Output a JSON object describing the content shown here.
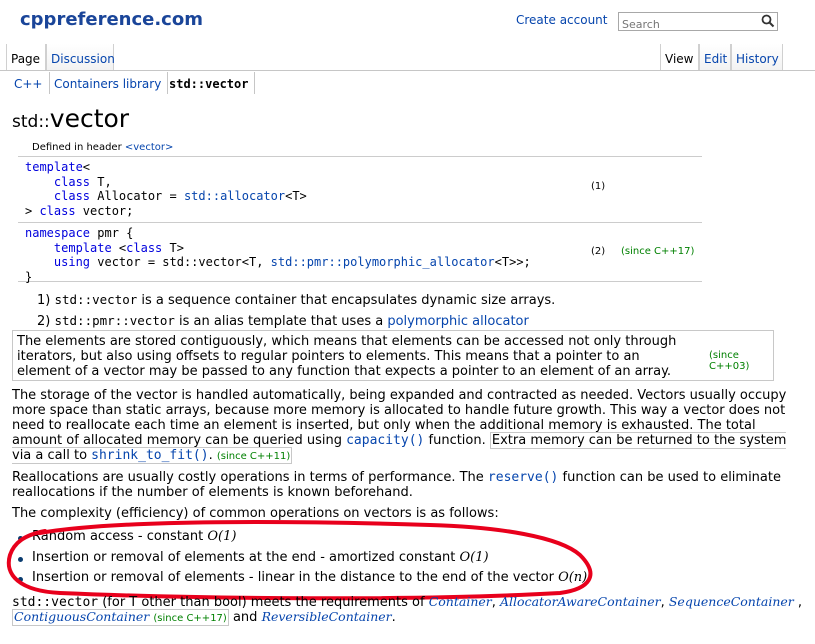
{
  "header": {
    "logo": "cppreference.com",
    "create_account": "Create account",
    "search_placeholder": "Search"
  },
  "tabs": {
    "page": "Page",
    "discussion": "Discussion",
    "view": "View",
    "edit": "Edit",
    "history": "History"
  },
  "breadcrumb": [
    "C++",
    "Containers library",
    "std::vector"
  ],
  "title": {
    "namespace": "std::",
    "name": "vector"
  },
  "declaration": {
    "defined_in_prefix": "Defined in header ",
    "header": "<vector>",
    "decl1": {
      "line1_kw": "template",
      "line1_rest": "<",
      "line2_kw": "class",
      "line2_rest": " T,",
      "line3_kw": "class",
      "line3_mid": " Allocator = ",
      "line3_id": "std::allocator",
      "line3_end": "<T>",
      "line4_pre": "> ",
      "line4_kw": "class",
      "line4_rest": " vector;",
      "number": "(1)"
    },
    "decl2": {
      "line1_kw": "namespace",
      "line1_rest": " pmr {",
      "line2_kw": "template",
      "line2_mid": " <",
      "line2_kw2": "class",
      "line2_end": " T>",
      "line3_kw": "using",
      "line3_mid": " vector = ",
      "line3_id1": "std::vector",
      "line3_mid2": "<T, ",
      "line3_id2": "std::pmr::polymorphic_allocator",
      "line3_end": "<T>>;",
      "line4": "}",
      "number": "(2)",
      "since": "(since C++17)"
    }
  },
  "descriptions": {
    "item1_num": "1)",
    "item1_code": "std::vector",
    "item1_text": " is a sequence container that encapsulates dynamic size arrays.",
    "item2_num": "2)",
    "item2_code": "std::pmr::vector",
    "item2_text": " is an alias template that uses a ",
    "item2_link": "polymorphic allocator"
  },
  "para_stored": {
    "text": "The elements are stored contiguously, which means that elements can be accessed not only through iterators, but also using offsets to regular pointers to elements. This means that a pointer to an element of a vector may be passed to any function that expects a pointer to an element of an array.",
    "since": "(since C++03)"
  },
  "para_storage": {
    "text1": "The storage of the vector is handled automatically, being expanded and contracted as needed. Vectors usually occupy more space than static arrays, because more memory is allocated to handle future growth. This way a vector does not need to reallocate each time an element is inserted, but only when the additional memory is exhausted. The total amount of allocated memory can be queried using ",
    "capacity": "capacity()",
    "text2": " function. ",
    "boxed_text": "Extra memory can be returned to the system via a call to ",
    "shrink": "shrink_to_fit()",
    "boxed_end": ".",
    "since": "(since C++11)"
  },
  "para_realloc": {
    "text1": "Reallocations are usually costly operations in terms of performance. The ",
    "reserve": "reserve()",
    "text2": " function can be used to eliminate reallocations if the number of elements is known beforehand."
  },
  "complexity_intro": "The complexity (efficiency) of common operations on vectors is as follows:",
  "complexity": [
    {
      "text": "Random access - constant ",
      "big_o": "O(1)"
    },
    {
      "text": "Insertion or removal of elements at the end - amortized constant ",
      "big_o": "O(1)"
    },
    {
      "text": "Insertion or removal of elements - linear in the distance to the end of the vector ",
      "big_o": "O(n)"
    }
  ],
  "requirements": {
    "code": "std::vector",
    "text1": " (for T other than bool) meets the requirements of ",
    "c1": "Container",
    "c2": "AllocatorAwareContainer",
    "c3": "SequenceContainer",
    "c4": "ContiguousContainer",
    "since": "(since C++17)",
    "and": " and ",
    "c5": "ReversibleContainer",
    "end": "."
  },
  "colors": {
    "link": "#0645ad",
    "since": "#008000",
    "annotation": "#e8001c",
    "logo": "#1a4599"
  }
}
